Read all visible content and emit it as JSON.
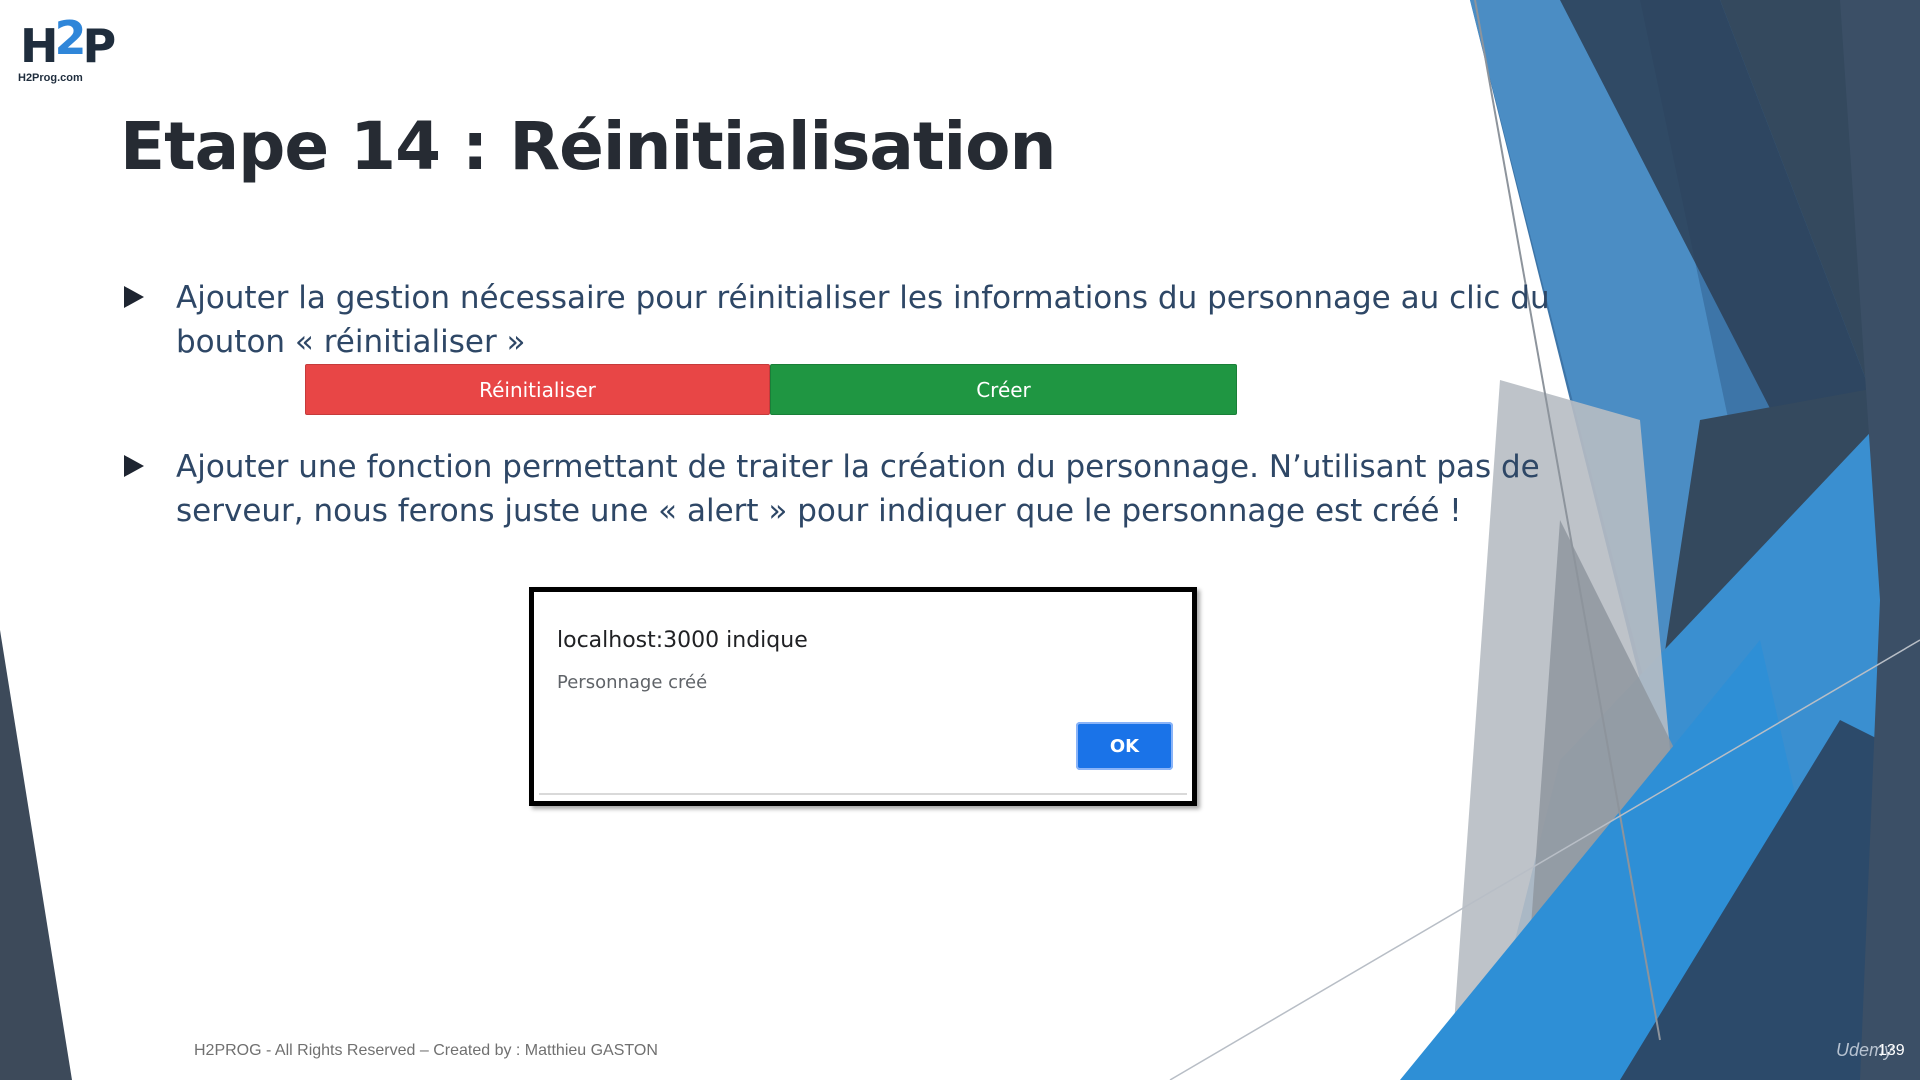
{
  "logo": {
    "letters_h": "H",
    "letters_2": "2",
    "letters_p": "P",
    "site": "H2Prog.com"
  },
  "title": "Etape 14 :  Réinitialisation",
  "bullets": [
    {
      "text": "Ajouter la gestion nécessaire pour réinitialiser les informations du personnage au clic du bouton « réinitialiser »"
    },
    {
      "text": "Ajouter une fonction permettant de traiter la création du personnage. N’utilisant pas de serveur, nous ferons juste une « alert » pour indiquer que le personnage est créé !"
    }
  ],
  "buttons": {
    "reset_label": "Réinitialiser",
    "create_label": "Créer",
    "reset_color": "#e84646",
    "create_color": "#1f9642"
  },
  "dialog": {
    "title": "localhost:3000 indique",
    "message": "Personnage créé",
    "ok_label": "OK"
  },
  "footer": {
    "text": "H2PROG - All Rights Reserved – Created by : Matthieu GASTON",
    "page_number": "139",
    "watermark": "Udemy"
  },
  "colors": {
    "title": "#262b33",
    "bullet_text": "#2e4766",
    "accent_blue": "#2f86d9",
    "dark_navy": "#2c3e55"
  }
}
